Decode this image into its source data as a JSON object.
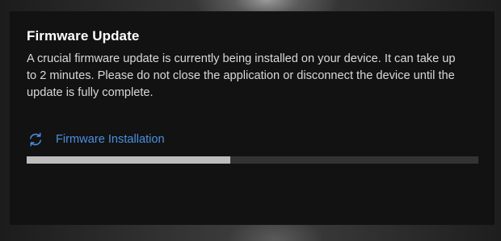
{
  "dialog": {
    "title": "Firmware Update",
    "description": "A crucial firmware update is currently being installed on your device. It can take up to 2 minutes. Please do not close the application or disconnect the device until the update is fully complete.",
    "status": {
      "icon": "sync-icon",
      "label": "Firmware Installation"
    },
    "progress": {
      "fraction": 0.45
    }
  },
  "colors": {
    "accent": "#4a90e2",
    "dialog_background": "#121212",
    "progress_fill": "#bdbdbd",
    "progress_track": "#333333"
  }
}
